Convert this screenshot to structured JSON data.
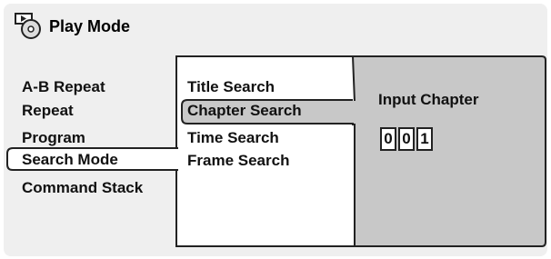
{
  "header": {
    "title": "Play Mode",
    "icon": "disc-play-icon"
  },
  "menu_col1": {
    "items": [
      {
        "label": "A-B Repeat"
      },
      {
        "label": "Repeat"
      },
      {
        "label": "Program"
      },
      {
        "label": "Search Mode",
        "selected": true
      },
      {
        "label": "Command Stack"
      }
    ]
  },
  "menu_col2": {
    "items": [
      {
        "label": "Title Search"
      },
      {
        "label": "Chapter Search",
        "selected": true
      },
      {
        "label": "Time Search"
      },
      {
        "label": "Frame Search"
      }
    ]
  },
  "panel": {
    "label": "Input Chapter",
    "digits": [
      "0",
      "0",
      "1"
    ]
  },
  "colors": {
    "panel_bg": "#c8c8c8",
    "selected_bg": "#c8c8c8",
    "outline": "#222222"
  }
}
